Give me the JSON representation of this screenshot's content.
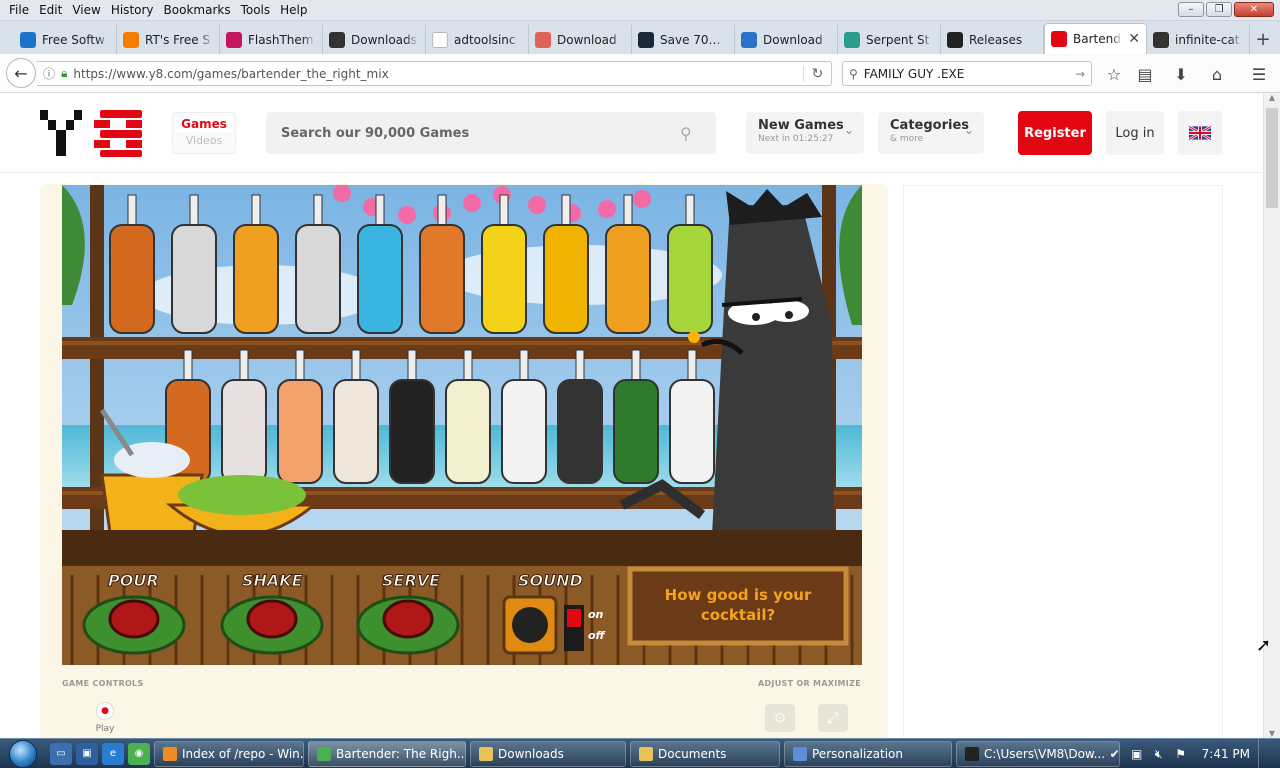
{
  "browser": {
    "menu": [
      "File",
      "Edit",
      "View",
      "History",
      "Bookmarks",
      "Tools",
      "Help"
    ],
    "tabs": [
      {
        "label": "Free Softw",
        "icon": "free-software-icon",
        "color": "#1a73c9"
      },
      {
        "label": "RT's Free S",
        "icon": "blogger-icon",
        "color": "#f57c00"
      },
      {
        "label": "FlashThem",
        "icon": "flashthemes-icon",
        "color": "#c2185b"
      },
      {
        "label": "Downloads",
        "icon": "download-icon",
        "color": "#333333"
      },
      {
        "label": "adtoolsinc",
        "icon": "blank-page-icon",
        "color": "#ffffff"
      },
      {
        "label": "Download",
        "icon": "download-site-icon",
        "color": "#e0635a"
      },
      {
        "label": "Save 70% o",
        "icon": "steam-icon",
        "color": "#1b2838"
      },
      {
        "label": "Download",
        "icon": "download-blue-icon",
        "color": "#2a72c8"
      },
      {
        "label": "Serpent St",
        "icon": "serpent-icon",
        "color": "#2a9d8f"
      },
      {
        "label": "Releases",
        "icon": "github-icon",
        "color": "#222222"
      },
      {
        "label": "Bartend",
        "icon": "y8-icon",
        "color": "#e30613",
        "active": true
      },
      {
        "label": "infinite-cat",
        "icon": "paw-icon",
        "color": "#333333"
      }
    ],
    "url": "https://www.y8.com/games/bartender_the_right_mix",
    "search_value": "FAMILY GUY .EXE"
  },
  "site": {
    "games_label": "Games",
    "videos_label": "Videos",
    "search_placeholder": "Search our 90,000 Games",
    "new_games_label": "New Games",
    "new_games_sub": "Next in 01:25:27",
    "categories_label": "Categories",
    "categories_sub": "& more",
    "register_label": "Register",
    "login_label": "Log in",
    "game_controls_label": "GAME CONTROLS",
    "adjust_label": "ADJUST OR MAXIMIZE",
    "play_label": "Play",
    "brand_red": "#e30613"
  },
  "game": {
    "buttons": [
      "POUR",
      "SHAKE",
      "SERVE",
      "SOUND"
    ],
    "on_label": "on",
    "off_label": "off",
    "sign_line1": "How good is your",
    "sign_line2": "cocktail?"
  },
  "taskbar": {
    "items": [
      {
        "label": "Index of /repo - Win...",
        "icon": "firefox-icon",
        "color": "#f08a24"
      },
      {
        "label": "Bartender: The Righ...",
        "icon": "chrome-icon",
        "color": "#4caf50",
        "active": true
      },
      {
        "label": "Downloads",
        "icon": "folder-icon",
        "color": "#e8c35a"
      },
      {
        "label": "Documents",
        "icon": "folder-icon",
        "color": "#e8c35a"
      },
      {
        "label": "Personalization",
        "icon": "control-panel-icon",
        "color": "#5d8fd8"
      },
      {
        "label": "C:\\Users\\VM8\\Dow...",
        "icon": "7zip-icon",
        "color": "#222222"
      }
    ],
    "clock": "7:41 PM"
  }
}
